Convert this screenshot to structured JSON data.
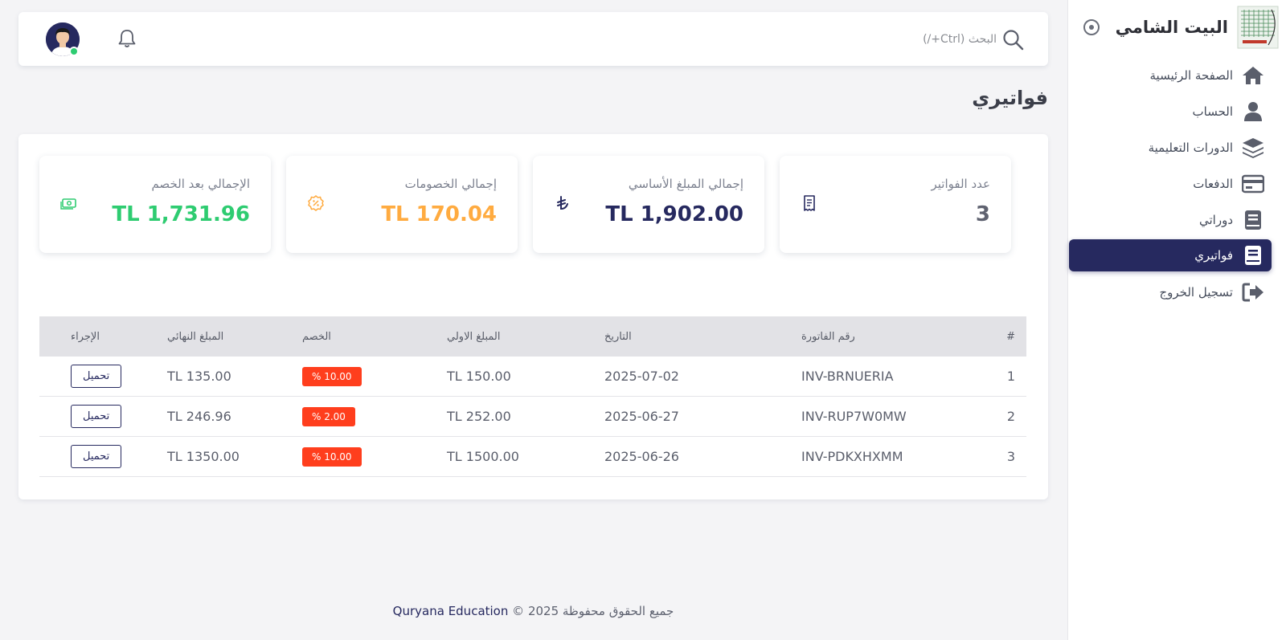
{
  "brand": {
    "name": "البيت الشامي"
  },
  "sidebar": {
    "items": [
      {
        "label": "الصفحة الرئيسية",
        "icon": "home-icon"
      },
      {
        "label": "الحساب",
        "icon": "user-icon"
      },
      {
        "label": "الدورات التعليمية",
        "icon": "layers-icon"
      },
      {
        "label": "الدفعات",
        "icon": "credit-card-icon"
      },
      {
        "label": "دوراتي",
        "icon": "book-icon"
      },
      {
        "label": "فواتيري",
        "icon": "book-icon",
        "active": true
      },
      {
        "label": "تسجيل الخروج",
        "icon": "logout-icon"
      }
    ]
  },
  "topbar": {
    "search_placeholder": "البحث (Ctrl+/)"
  },
  "page": {
    "title": "فواتيري"
  },
  "stats": [
    {
      "label": "عدد الفواتير",
      "value": "3",
      "color": "#5f6270",
      "icon": "receipt-icon"
    },
    {
      "label": "إجمالي المبلغ الأساسي",
      "value": "TL 1,902.00",
      "color": "#26295f",
      "icon": "lira-icon"
    },
    {
      "label": "إجمالي الخصومات",
      "value": "TL 170.04",
      "color": "#ffab40",
      "icon": "discount-icon"
    },
    {
      "label": "الإجمالي بعد الخصم",
      "value": "TL 1,731.96",
      "color": "#2ecc71",
      "icon": "cash-icon"
    }
  ],
  "table": {
    "headers": {
      "num": "#",
      "invoice": "رقم الفاتورة",
      "date": "التاريخ",
      "amount": "المبلغ الاولي",
      "discount": "الخصم",
      "final": "المبلغ النهائي",
      "action": "الإجراء"
    },
    "rows": [
      {
        "num": "1",
        "invoice": "INV-BRNUERIA",
        "date": "2025-07-02",
        "amount": "TL 150.00",
        "discount": "% 10.00",
        "final": "TL 135.00",
        "action": "تحميل"
      },
      {
        "num": "2",
        "invoice": "INV-RUP7W0MW",
        "date": "2025-06-27",
        "amount": "TL 252.00",
        "discount": "% 2.00",
        "final": "TL 246.96",
        "action": "تحميل"
      },
      {
        "num": "3",
        "invoice": "INV-PDKXHXMM",
        "date": "2025-06-26",
        "amount": "TL 1500.00",
        "discount": "% 10.00",
        "final": "TL 1350.00",
        "action": "تحميل"
      }
    ]
  },
  "footer": {
    "text": "جميع الحقوق محفوظة 2025 ©",
    "brand": "Quryana Education"
  },
  "colors": {
    "primary": "#26295f",
    "danger": "#ff3e1d",
    "success": "#2ecc71",
    "warning": "#ffab40"
  }
}
